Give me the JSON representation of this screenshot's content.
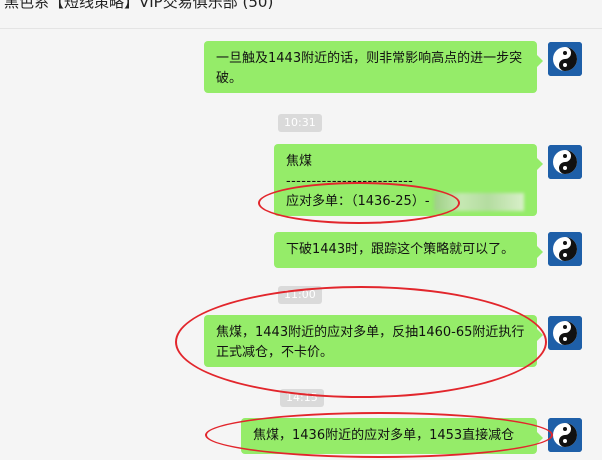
{
  "window": {
    "title": "黑色系【短线策略】VIP交易俱乐部 (50)"
  },
  "messages": [
    {
      "text": "一旦触及1443附近的话，则非常影响高点的进一步突破。"
    },
    {
      "title": "焦煤",
      "separator": "-------------------------",
      "line": "应对多单：（1436-25）-"
    },
    {
      "text": "下破1443时，跟踪这个策略就可以了。"
    },
    {
      "text": "焦煤，1443附近的应对多单，反抽1460-65附近执行正式减仓，不卡价。"
    },
    {
      "text": "焦煤，1436附近的应对多单，1453直接减仓"
    }
  ],
  "timestamps": [
    "10:31",
    "11:00",
    "14:15"
  ],
  "avatar": {
    "icon": "taichi-yin-yang-icon"
  },
  "colors": {
    "bubble": "#95ec69",
    "annotation": "#e2262c",
    "avatar_bg": "#1e5fa8"
  }
}
